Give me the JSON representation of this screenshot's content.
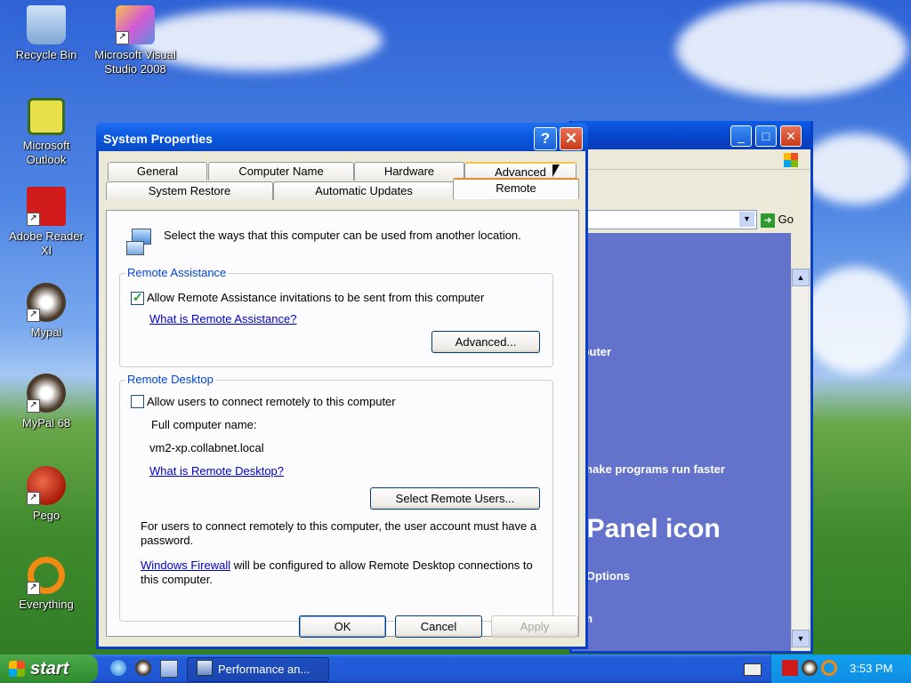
{
  "desktop": {
    "icons": [
      {
        "label": "Recycle Bin"
      },
      {
        "label": "Microsoft Visual Studio 2008"
      },
      {
        "label": "Microsoft Outlook"
      },
      {
        "label": "Adobe Reader XI"
      },
      {
        "label": "Mypal"
      },
      {
        "label": "MyPal 68"
      },
      {
        "label": "Pego"
      },
      {
        "label": "Everything"
      }
    ]
  },
  "bg_window": {
    "go_label": "Go",
    "text1": "mputer",
    "text2": "o make programs run faster",
    "text3": "l Panel icon",
    "text4": "er Options",
    "text5": "tem"
  },
  "dialog": {
    "title": "System Properties",
    "help_label": "?",
    "close_label": "✕",
    "tabs_row1": [
      "General",
      "Computer Name",
      "Hardware",
      "Advanced"
    ],
    "tabs_row2": [
      "System Restore",
      "Automatic Updates",
      "Remote"
    ],
    "intro": "Select the ways that this computer can be used from another location.",
    "remote_assistance": {
      "label": "Remote Assistance",
      "checkbox_label": "Allow Remote Assistance invitations to be sent from this computer",
      "checked": true,
      "link": "What is Remote Assistance?",
      "advanced_button": "Advanced..."
    },
    "remote_desktop": {
      "label": "Remote Desktop",
      "checkbox_label": "Allow users to connect remotely to this computer",
      "checked": false,
      "full_name_label": "Full computer name:",
      "full_name_value": "vm2-xp.collabnet.local",
      "link": "What is Remote Desktop?",
      "select_users_button": "Select Remote Users...",
      "note1": "For users to connect remotely to this computer, the user account must have a password.",
      "firewall_link": "Windows Firewall",
      "note2": " will be configured to allow Remote Desktop connections to this computer."
    },
    "ok": "OK",
    "cancel": "Cancel",
    "apply": "Apply"
  },
  "taskbar": {
    "start": "start",
    "task_label": "Performance an...",
    "clock": "3:53 PM"
  },
  "colors": {
    "title_blue": "#0a58e0",
    "start_green": "#3a9a3a",
    "link_blue": "#0000cc"
  }
}
